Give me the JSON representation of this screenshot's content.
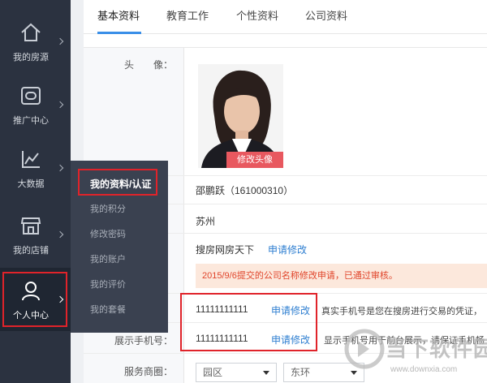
{
  "sidebar": {
    "items": [
      {
        "label": "我的房源",
        "icon": "home-icon"
      },
      {
        "label": "推广中心",
        "icon": "promotion-icon"
      },
      {
        "label": "大数据",
        "icon": "chart-icon"
      },
      {
        "label": "我的店铺",
        "icon": "shop-icon"
      },
      {
        "label": "个人中心",
        "icon": "user-icon"
      }
    ]
  },
  "flyout": {
    "items": [
      "我的资料/认证",
      "我的积分",
      "修改密码",
      "我的账户",
      "我的评价",
      "我的套餐"
    ]
  },
  "tabs": [
    "基本资料",
    "教育工作",
    "个性资料",
    "公司资料"
  ],
  "form": {
    "avatar_label": "头　　像：",
    "avatar_button": "修改头像",
    "name_value": "邵鹏跃（161000310）",
    "city_value": "苏州",
    "company_value": "搜房网房天下",
    "company_link": "申请修改",
    "notice": "2015/9/6提交的公司名称修改申请，已通过审核。",
    "phone_value": "11111111111",
    "phone_link": "申请修改",
    "phone_note": "真实手机号是您在搜房进行交易的凭证，",
    "display_phone_label": "展示手机号：",
    "display_phone_value": "11111111111",
    "display_phone_link": "申请修改",
    "display_phone_note": "显示手机号用于前台展示，请保证手机畅",
    "service_label": "服务商圈：",
    "select_district": "园区",
    "select_area": "东环"
  },
  "watermark": {
    "cn": "当下软件园",
    "en": "www.downxia.com"
  },
  "colors": {
    "sidebar_bg": "#2b3240",
    "highlight_red": "#e0232a",
    "link_blue": "#2f7fd1",
    "tab_accent": "#3a8fe8"
  }
}
